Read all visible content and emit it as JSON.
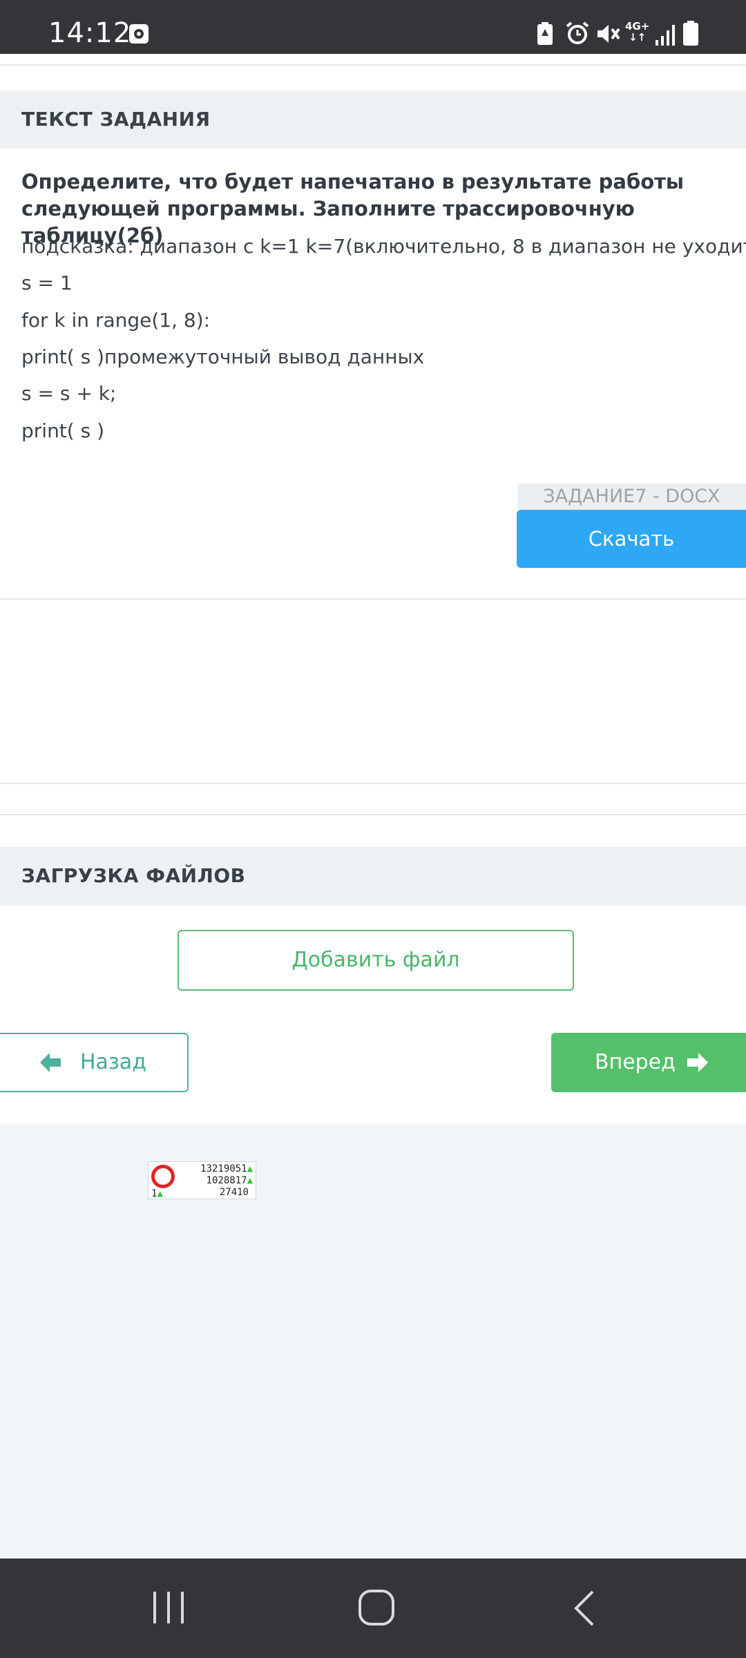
{
  "status_bar": {
    "time": "14:12",
    "network": {
      "top": "4G+",
      "bottom": "↓↑"
    },
    "icons": [
      "media-icon",
      "battery-saver-icon",
      "alarm-icon",
      "mute-icon",
      "network-4g-icon",
      "signal-icon",
      "battery-icon"
    ]
  },
  "task": {
    "header": "ТЕКСТ ЗАДАНИЯ",
    "question": "Определите, что будет напечатано в результате работы следующей программы. Заполните трассировочную таблицу(2б)",
    "lines": [
      "подсказка: диапазон с k=1 k=7(включительно, 8 в диапазон не уходит)",
      "s = 1",
      "for k in range(1, 8):",
      "print( s )промежуточный вывод данных",
      "s = s + k;",
      "print( s )"
    ],
    "attachment": {
      "file_name": "ЗАДАНИЕ7 - DOCX",
      "download_label": "Скачать"
    }
  },
  "upload": {
    "header": "ЗАГРУЗКА ФАЙЛОВ",
    "add_file_label": "Добавить файл"
  },
  "navigation": {
    "back_label": "Назад",
    "next_label": "Вперед"
  },
  "counter_widget": {
    "line1": "13219051",
    "line2": "1028817",
    "line3": "27410",
    "left_value": "1"
  },
  "colors": {
    "accent_blue": "#2ea7f5",
    "accent_green": "#55c06b",
    "outline_green": "#5cb97a",
    "teal": "#4fb09c"
  }
}
